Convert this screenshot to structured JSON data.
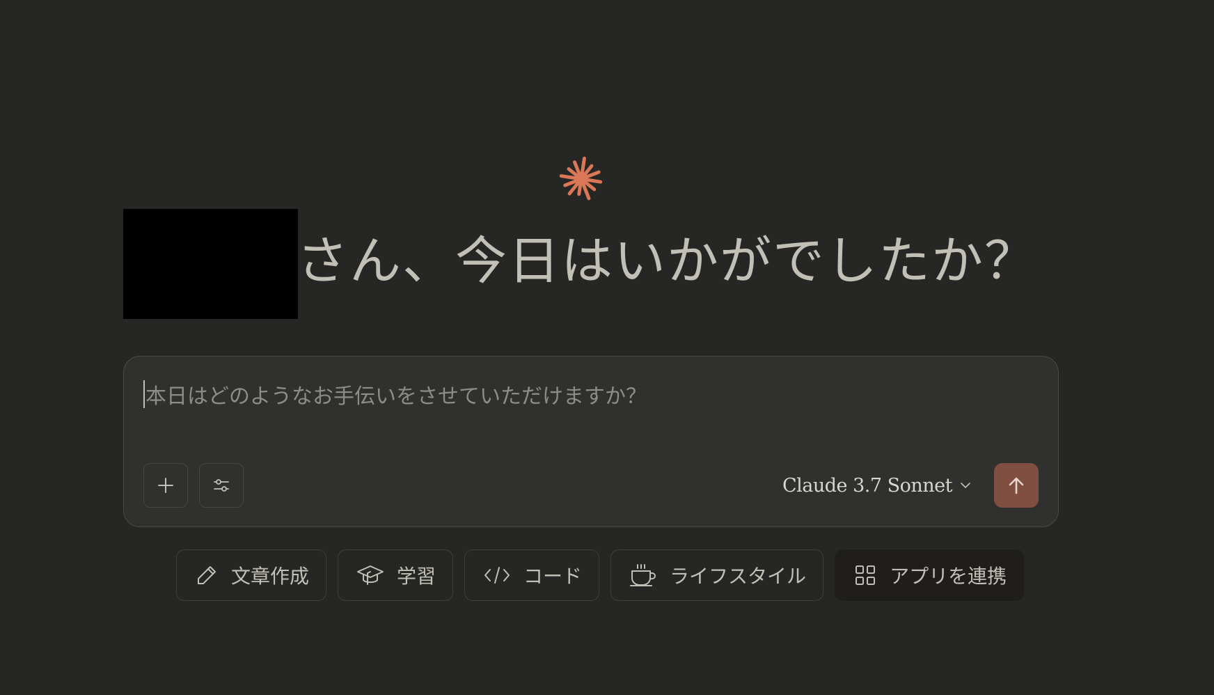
{
  "greeting": {
    "redacted_name": "",
    "text": "さん、今日はいかがでしたか？"
  },
  "composer": {
    "placeholder": "本日はどのようなお手伝いをさせていただけますか？",
    "model_label": "Claude 3.7 Sonnet"
  },
  "icons": {
    "logo": "claude-spark-icon",
    "add": "plus-icon",
    "tools": "sliders-icon",
    "model": "chevron-down-icon",
    "send": "arrow-up-icon"
  },
  "chips": [
    {
      "label": "文章作成",
      "icon": "pencil-icon"
    },
    {
      "label": "学習",
      "icon": "graduation-cap-icon"
    },
    {
      "label": "コード",
      "icon": "code-icon"
    },
    {
      "label": "ライフスタイル",
      "icon": "coffee-cup-icon"
    },
    {
      "label": "アプリを連携",
      "icon": "grid-icon"
    }
  ],
  "colors": {
    "background": "#262624",
    "accent": "#d97757",
    "send_button": "#814f42",
    "composer": "#30302e"
  }
}
